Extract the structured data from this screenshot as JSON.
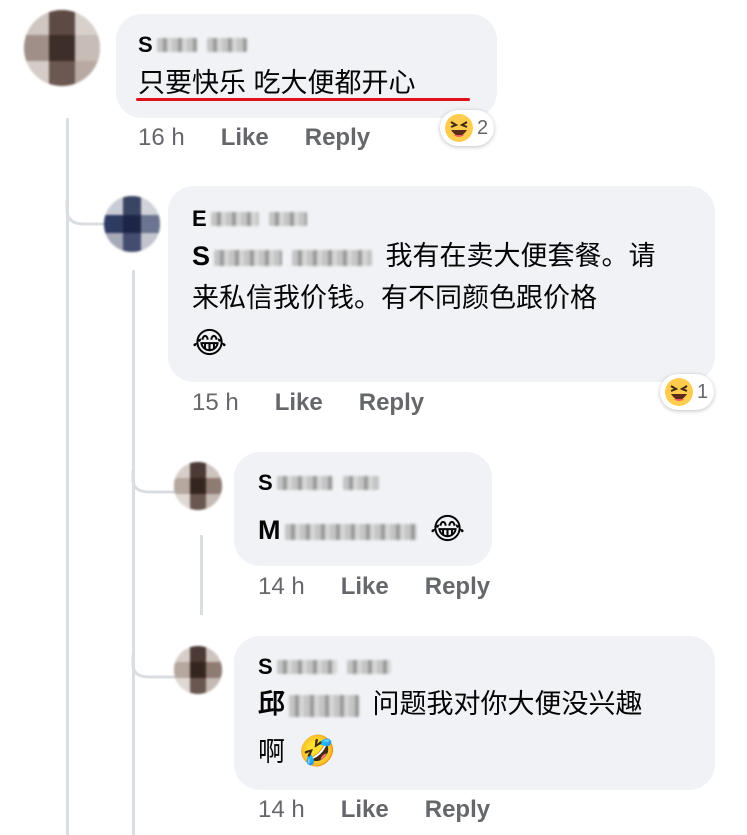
{
  "comments": [
    {
      "author_visible": "S",
      "text": "只要快乐 吃大便都开心",
      "time": "16 h",
      "like": "Like",
      "reply": "Reply",
      "reaction_icon": "grinning-squinting-face",
      "reaction_count": "2"
    },
    {
      "author_visible": "E",
      "mention_visible": "S",
      "text_line1": "我有在卖大便套餐。请",
      "text_line2": "来私信我价钱。有不同颜色跟价格",
      "emoji_line": "😂",
      "time": "15 h",
      "like": "Like",
      "reply": "Reply",
      "reaction_icon": "grinning-squinting-face",
      "reaction_count": "1"
    },
    {
      "author_visible": "S",
      "mention_visible": "M",
      "emoji": "😂",
      "time": "14 h",
      "like": "Like",
      "reply": "Reply"
    },
    {
      "author_visible": "S",
      "mention_visible": "邱",
      "text_line1": "问题我对你大便没兴趣",
      "text_line2": "啊",
      "emoji": "🤣",
      "time": "14 h",
      "like": "Like",
      "reply": "Reply"
    }
  ],
  "colors": {
    "bubble": "#f0f2f5",
    "meta": "#65676b",
    "thread_line": "#dadde1",
    "highlight_underline": "#e0101a",
    "emoji_yellow": "#ffcc4d"
  }
}
